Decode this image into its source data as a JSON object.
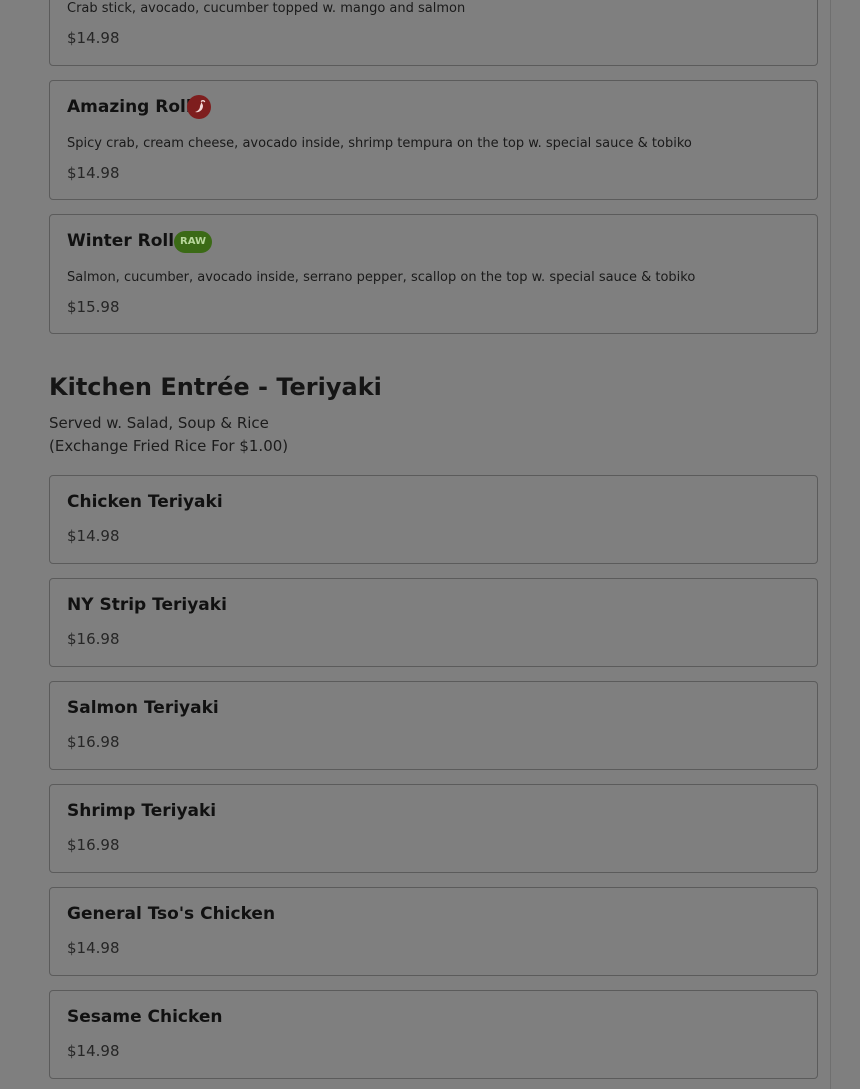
{
  "top_items": [
    {
      "description": "Crab stick, avocado, cucumber topped w. mango and salmon",
      "price": "$14.98"
    },
    {
      "name": "Amazing Roll",
      "icon": "spicy-icon",
      "description": "Spicy crab, cream cheese, avocado inside, shrimp tempura on the top w. special sauce & tobiko",
      "price": "$14.98"
    },
    {
      "name": "Winter Roll",
      "badge": "RAW",
      "description": "Salmon, cucumber, avocado inside, serrano pepper, scallop on the top w. special sauce & tobiko",
      "price": "$15.98"
    }
  ],
  "section": {
    "title": "Kitchen Entrée - Teriyaki",
    "note_line1": "Served w. Salad, Soup & Rice",
    "note_line2": "(Exchange Fried Rice For $1.00)"
  },
  "teriyaki_items": [
    {
      "name": "Chicken Teriyaki",
      "price": "$14.98"
    },
    {
      "name": "NY Strip Teriyaki",
      "price": "$16.98"
    },
    {
      "name": "Salmon Teriyaki",
      "price": "$16.98"
    },
    {
      "name": "Shrimp Teriyaki",
      "price": "$16.98"
    },
    {
      "name": "General Tso's Chicken",
      "price": "$14.98"
    },
    {
      "name": "Sesame Chicken",
      "price": "$14.98"
    }
  ],
  "colors": {
    "spicy_icon": "#7e1e1e",
    "raw_badge_bg": "#3b6a16",
    "raw_badge_text": "#b7d69a",
    "overlay": "#7f7f7f"
  }
}
